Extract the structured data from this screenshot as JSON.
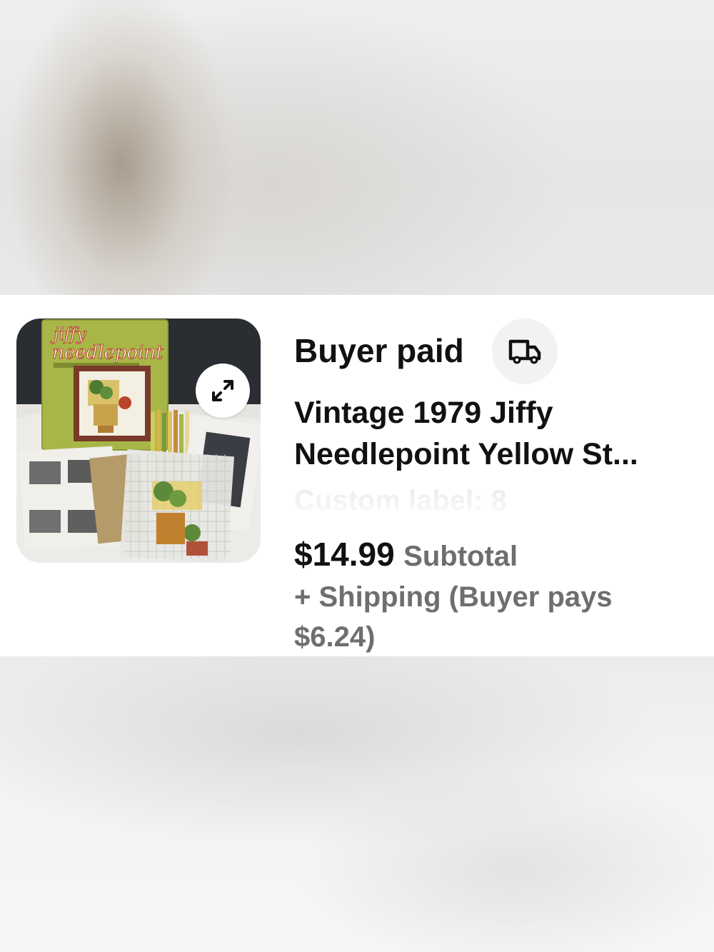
{
  "order": {
    "status_label": "Buyer paid",
    "status_icon": "truck-icon",
    "title_line1": "Vintage 1979 Jiffy",
    "title_line2": "Needlepoint Yellow St...",
    "custom_label": "Custom label: 8",
    "price": "$14.99",
    "price_caption": "Subtotal",
    "shipping_line1": "+ Shipping (Buyer pays",
    "shipping_line2": "$6.24)"
  },
  "photo": {
    "brand_line1": "jiffy",
    "brand_line2": "needlepoint",
    "expand_icon": "expand-arrows-icon"
  }
}
